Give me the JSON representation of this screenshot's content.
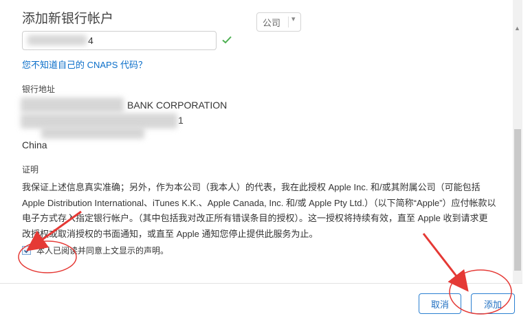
{
  "dialog": {
    "title": "添加新银行帐户"
  },
  "account_type_select": {
    "selected_value": "公司"
  },
  "account_number": {
    "value": "4",
    "validation_icon": "check-icon",
    "validation_color": "#4caf50"
  },
  "cnaps_link": "您不知道自己的 CNAPS 代码？",
  "bank_address": {
    "label": "银行地址",
    "line1": "BANK CORPORATION",
    "line2": "1",
    "country": "China"
  },
  "certification": {
    "label": "证明",
    "text": "我保证上述信息真实准确；另外，作为本公司（我本人）的代表，我在此授权 Apple Inc. 和/或其附属公司（可能包括 Apple Distribution International、iTunes K.K.、Apple Canada, Inc. 和/或 Apple Pty Ltd.）（以下简称“Apple”）应付帐款以电子方式存入指定银行帐户。（其中包括我对改正所有错误条目的授权）。这一授权将持续有效，直至 Apple 收到请求更改授权或取消授权的书面通知，或直至 Apple 通知您停止提供此服务为止。",
    "agree_label": "本人已阅读并同意上文显示的声明。",
    "agree_checked": true
  },
  "buttons": {
    "cancel": "取消",
    "add": "添加"
  },
  "colors": {
    "link": "#0a6ec9",
    "button_border": "#2a7fd1",
    "annotation": "#e53935"
  }
}
